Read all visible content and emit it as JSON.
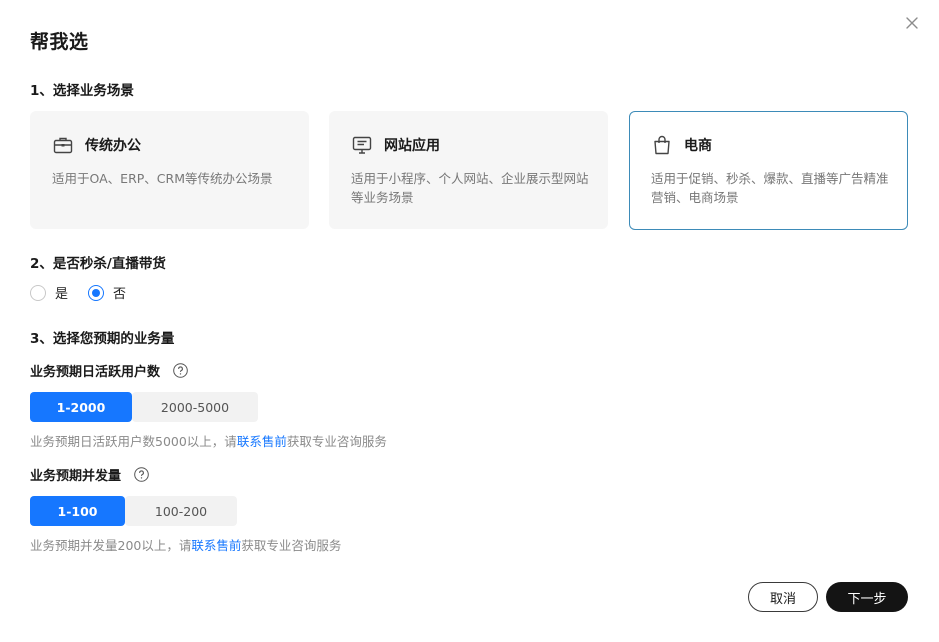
{
  "dialog": {
    "title": "帮我选"
  },
  "section1": {
    "title": "1、选择业务场景",
    "cards": [
      {
        "name": "传统办公",
        "desc": "适用于OA、ERP、CRM等传统办公场景",
        "icon": "briefcase-icon",
        "selected": false
      },
      {
        "name": "网站应用",
        "desc": "适用于小程序、个人网站、企业展示型网站等业务场景",
        "icon": "monitor-icon",
        "selected": false
      },
      {
        "name": "电商",
        "desc": "适用于促销、秒杀、爆款、直播等广告精准营销、电商场景",
        "icon": "shopping-bag-icon",
        "selected": true
      }
    ]
  },
  "section2": {
    "title": "2、是否秒杀/直播带货",
    "options": [
      {
        "label": "是",
        "checked": false
      },
      {
        "label": "否",
        "checked": true
      }
    ]
  },
  "section3": {
    "title": "3、选择您预期的业务量",
    "dau": {
      "label": "业务预期日活跃用户数",
      "options": [
        {
          "label": "1-2000",
          "selected": true
        },
        {
          "label": "2000-5000",
          "selected": false
        }
      ],
      "hint_prefix": "业务预期日活跃用户数5000以上，请",
      "hint_link": "联系售前",
      "hint_suffix": "获取专业咨询服务"
    },
    "concurrency": {
      "label": "业务预期并发量",
      "options": [
        {
          "label": "1-100",
          "selected": true
        },
        {
          "label": "100-200",
          "selected": false
        }
      ],
      "hint_prefix": "业务预期并发量200以上，请",
      "hint_link": "联系售前",
      "hint_suffix": "获取专业咨询服务"
    }
  },
  "footer": {
    "cancel_label": "取消",
    "next_label": "下一步"
  },
  "colors": {
    "accent": "#1677ff",
    "selected_border": "#3d8bb8",
    "primary_button": "#141414"
  }
}
